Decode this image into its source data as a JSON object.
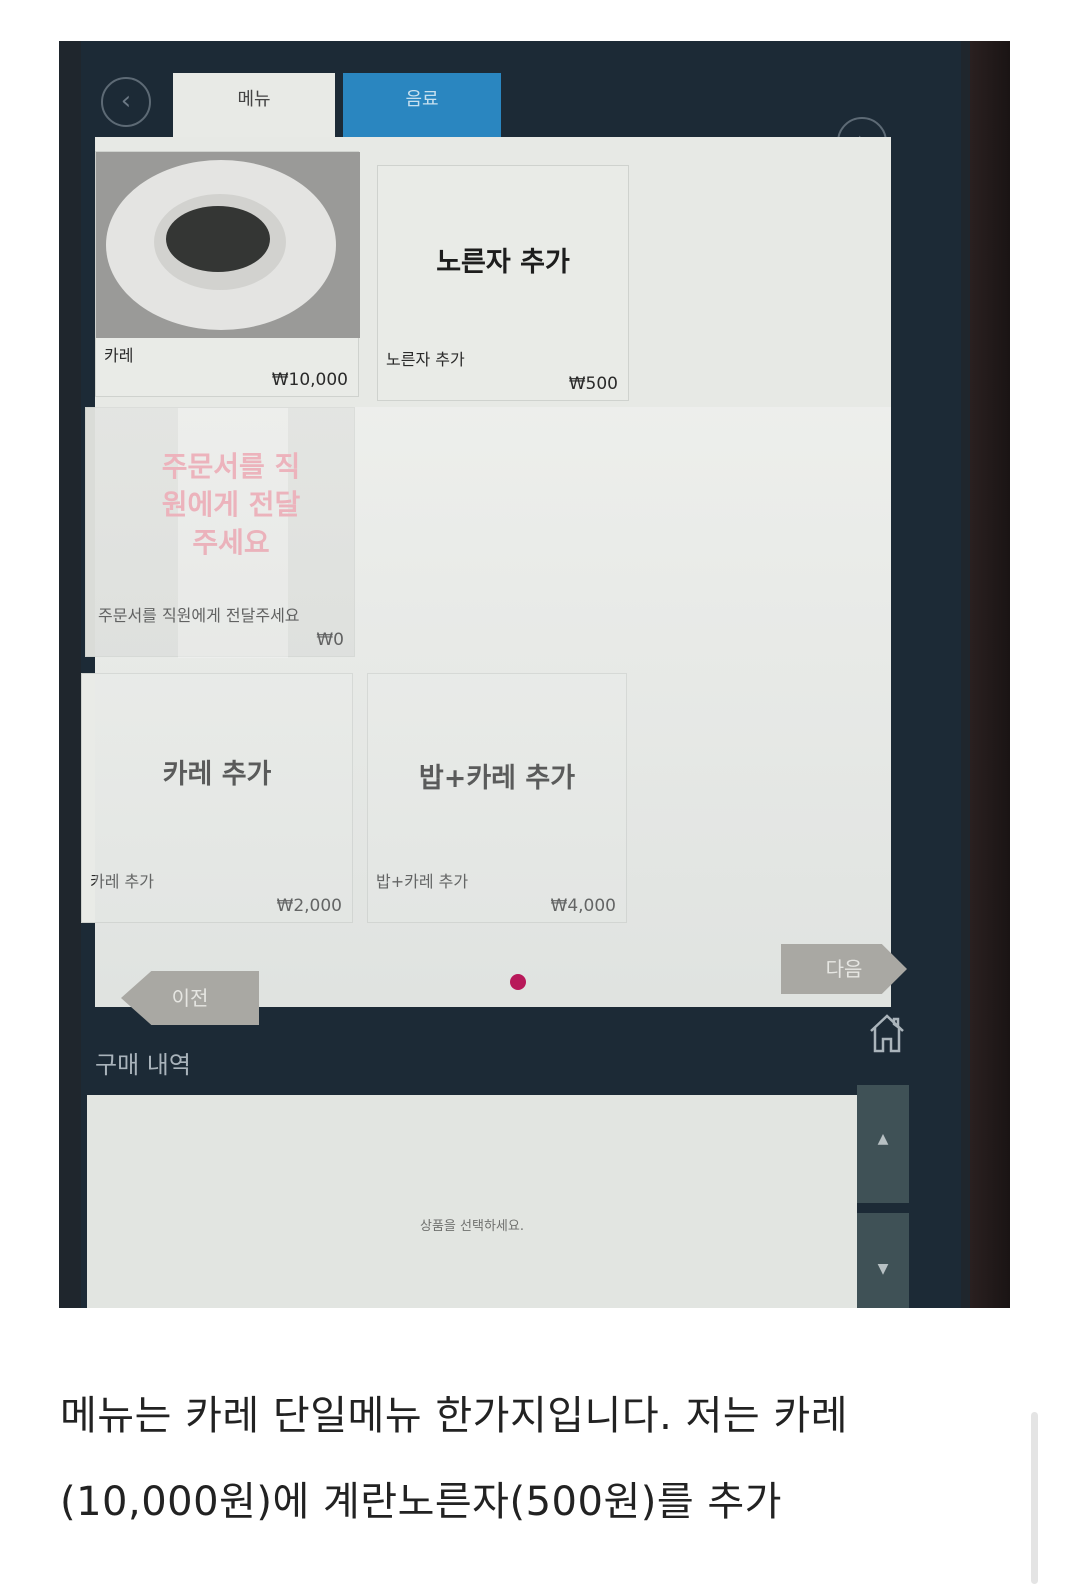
{
  "kiosk": {
    "tabs": [
      {
        "label": "메뉴"
      },
      {
        "label": "음료"
      }
    ],
    "products": [
      {
        "title": "",
        "name": "카레",
        "price": "₩10,000"
      },
      {
        "title": "노른자 추가",
        "name": "노른자 추가",
        "price": "₩500"
      },
      {
        "title": "주문서를 직원에게 전달주세요",
        "name": "주문서를 직원에게 전달주세요",
        "price": "₩0"
      },
      {
        "title": "카레 추가",
        "name": "카레 추가",
        "price": "₩2,000"
      },
      {
        "title": "밥+카레 추가",
        "name": "밥+카레 추가",
        "price": "₩4,000"
      }
    ],
    "nav": {
      "prev_label": "이전",
      "next_label": "다음"
    },
    "pagination": {
      "current_page": 1,
      "total_pages": 1
    },
    "purchase": {
      "title": "구매 내역",
      "empty_message": "상품을 선택하세요."
    },
    "scroll": {
      "up": "▲",
      "down": "▼"
    },
    "icons": {
      "back": "chevron-left-icon",
      "forward": "chevron-right-icon",
      "home": "home-icon"
    },
    "colors": {
      "active_tab": "#e8eae6",
      "drink_tab": "#2a86c0",
      "page_dot": "#b8195a",
      "screen_bg": "#1c2a36"
    }
  },
  "caption": {
    "line1": "메뉴는 카레 단일메뉴 한가지입니다. 저는 카레",
    "line2": "(10,000원)에 계란노른자(500원)를 추가"
  }
}
